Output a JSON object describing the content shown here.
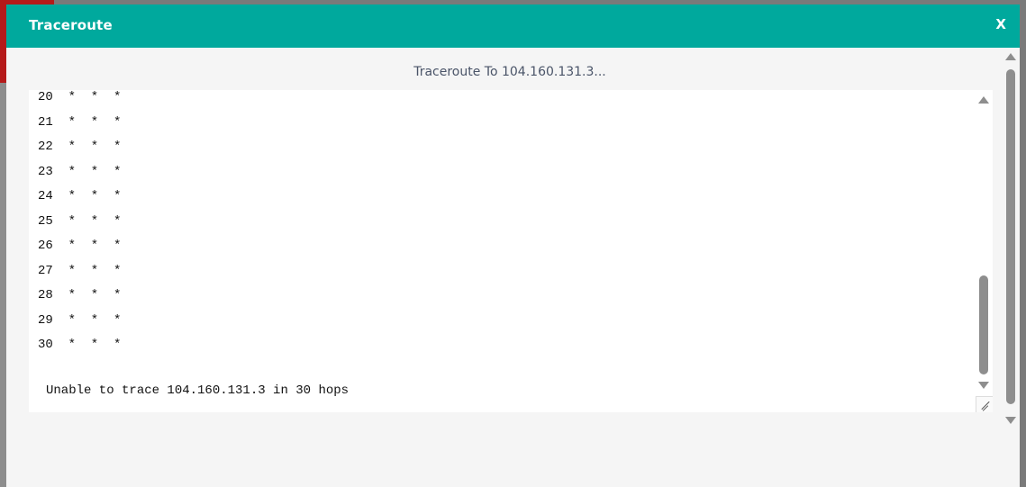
{
  "dialog": {
    "title": "Traceroute",
    "close_label": "X",
    "subtitle": "Traceroute To 104.160.131.3..."
  },
  "output": {
    "lines": [
      "20  *  *  *",
      "21  *  *  *",
      "22  *  *  *",
      "23  *  *  *",
      "24  *  *  *",
      "25  *  *  *",
      "26  *  *  *",
      "27  *  *  *",
      "28  *  *  *",
      "29  *  *  *",
      "30  *  *  *"
    ],
    "message": "Unable to trace 104.160.131.3 in 30 hops"
  },
  "colors": {
    "header": "#00a99d",
    "dialog_bg": "#f5f5f5",
    "output_bg": "#ffffff"
  }
}
